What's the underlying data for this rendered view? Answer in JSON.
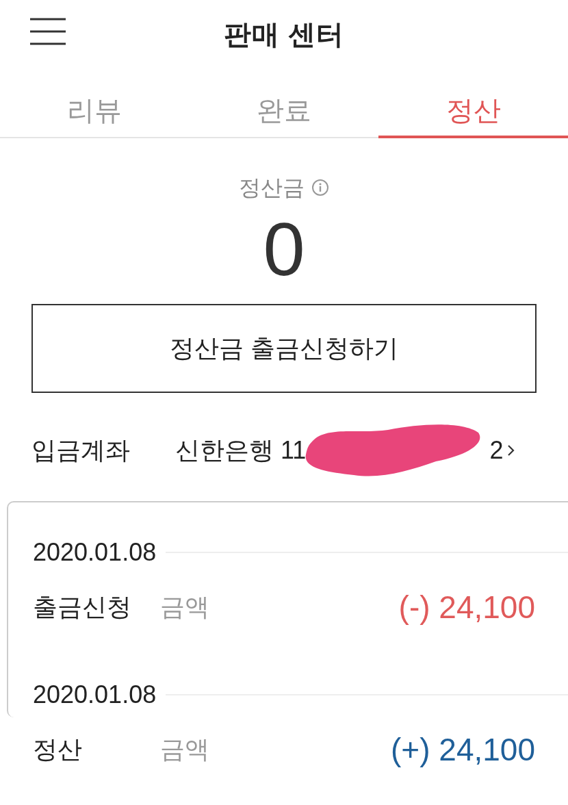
{
  "header": {
    "title": "판매 센터"
  },
  "tabs": [
    {
      "label": "리뷰",
      "selected": false
    },
    {
      "label": "완료",
      "selected": false
    },
    {
      "label": "정산",
      "selected": true
    }
  ],
  "balance": {
    "label": "정산금",
    "amount": "0"
  },
  "withdraw_button": "정산금 출금신청하기",
  "account": {
    "label": "입금계좌",
    "bank": "신한은행 11",
    "tail": "2",
    "redacted": true
  },
  "transactions": [
    {
      "date": "2020.01.08",
      "type": "출금신청",
      "amount_label": "금액",
      "amount": "(-) 24,100",
      "color": "#e05a5a"
    },
    {
      "date": "2020.01.08",
      "type": "정산",
      "amount_label": "금액",
      "amount": "(+) 24,100",
      "color": "#1f5f99"
    }
  ]
}
